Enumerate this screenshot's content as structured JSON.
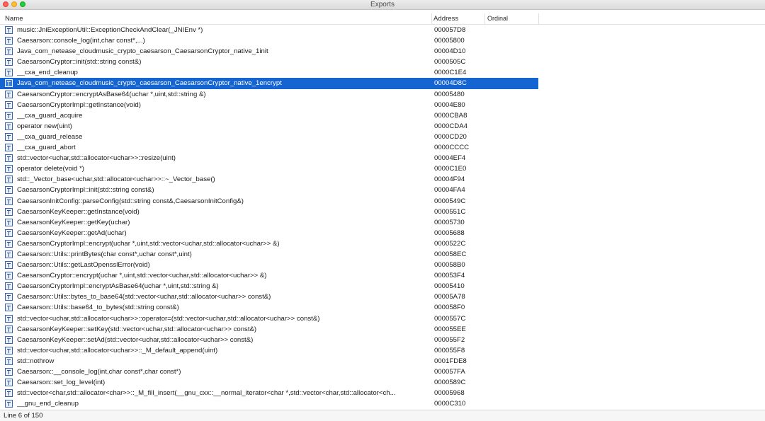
{
  "window": {
    "title": "Exports"
  },
  "columns": {
    "name": "Name",
    "address": "Address",
    "ordinal": "Ordinal"
  },
  "selected_index": 5,
  "rows": [
    {
      "name": "music::JniExceptionUtil::ExceptionCheckAndClear(_JNIEnv *)",
      "address": "000057D8"
    },
    {
      "name": "Caesarson::console_log(int,char const*,...)",
      "address": "00005800"
    },
    {
      "name": "Java_com_netease_cloudmusic_crypto_caesarson_CaesarsonCryptor_native_1init",
      "address": "00004D10"
    },
    {
      "name": "CaesarsonCryptor::init(std::string const&)",
      "address": "0000505C"
    },
    {
      "name": "__cxa_end_cleanup",
      "address": "0000C1E4"
    },
    {
      "name": "Java_com_netease_cloudmusic_crypto_caesarson_CaesarsonCryptor_native_1encrypt",
      "address": "00004D8C"
    },
    {
      "name": "CaesarsonCryptor::encryptAsBase64(uchar *,uint,std::string &)",
      "address": "00005480"
    },
    {
      "name": "CaesarsonCryptorImpl::getInstance(void)",
      "address": "00004E80"
    },
    {
      "name": "__cxa_guard_acquire",
      "address": "0000CBA8"
    },
    {
      "name": "operator new(uint)",
      "address": "0000CDA4"
    },
    {
      "name": "__cxa_guard_release",
      "address": "0000CD20"
    },
    {
      "name": "__cxa_guard_abort",
      "address": "0000CCCC"
    },
    {
      "name": "std::vector<uchar,std::allocator<uchar>>::resize(uint)",
      "address": "00004EF4"
    },
    {
      "name": "operator delete(void *)",
      "address": "0000C1E0"
    },
    {
      "name": "std::_Vector_base<uchar,std::allocator<uchar>>::~_Vector_base()",
      "address": "00004F94"
    },
    {
      "name": "CaesarsonCryptorImpl::init(std::string const&)",
      "address": "00004FA4"
    },
    {
      "name": "CaesarsonInitConfig::parseConfig(std::string const&,CaesarsonInitConfig&)",
      "address": "0000549C"
    },
    {
      "name": "CaesarsonKeyKeeper::getInstance(void)",
      "address": "0000551C"
    },
    {
      "name": "CaesarsonKeyKeeper::getKey(uchar)",
      "address": "00005730"
    },
    {
      "name": "CaesarsonKeyKeeper::getAd(uchar)",
      "address": "00005688"
    },
    {
      "name": "CaesarsonCryptorImpl::encrypt(uchar *,uint,std::vector<uchar,std::allocator<uchar>> &)",
      "address": "0000522C"
    },
    {
      "name": "Caesarson::Utils::printBytes(char const*,uchar const*,uint)",
      "address": "000058EC"
    },
    {
      "name": "Caesarson::Utils::getLastOpensslError(void)",
      "address": "000058B0"
    },
    {
      "name": "CaesarsonCryptor::encrypt(uchar *,uint,std::vector<uchar,std::allocator<uchar>> &)",
      "address": "000053F4"
    },
    {
      "name": "CaesarsonCryptorImpl::encryptAsBase64(uchar *,uint,std::string &)",
      "address": "00005410"
    },
    {
      "name": "Caesarson::Utils::bytes_to_base64(std::vector<uchar,std::allocator<uchar>> const&)",
      "address": "00005A78"
    },
    {
      "name": "Caesarson::Utils::base64_to_bytes(std::string const&)",
      "address": "000058F0"
    },
    {
      "name": "std::vector<uchar,std::allocator<uchar>>::operator=(std::vector<uchar,std::allocator<uchar>> const&)",
      "address": "0000557C"
    },
    {
      "name": "CaesarsonKeyKeeper::setKey(std::vector<uchar,std::allocator<uchar>> const&)",
      "address": "000055EE"
    },
    {
      "name": "CaesarsonKeyKeeper::setAd(std::vector<uchar,std::allocator<uchar>> const&)",
      "address": "000055F2"
    },
    {
      "name": "std::vector<uchar,std::allocator<uchar>>::_M_default_append(uint)",
      "address": "000055F8"
    },
    {
      "name": "std::nothrow",
      "address": "0001FDE8"
    },
    {
      "name": "Caesarson::__console_log(int,char const*,char const*)",
      "address": "000057FA"
    },
    {
      "name": "Caesarson::set_log_level(int)",
      "address": "0000589C"
    },
    {
      "name": "std::vector<char,std::allocator<char>>::_M_fill_insert(__gnu_cxx::__normal_iterator<char *,std::vector<char,std::allocator<ch...",
      "address": "00005968"
    },
    {
      "name": "__gnu_end_cleanup",
      "address": "0000C310"
    }
  ],
  "status": {
    "text": "Line 6 of 150"
  }
}
